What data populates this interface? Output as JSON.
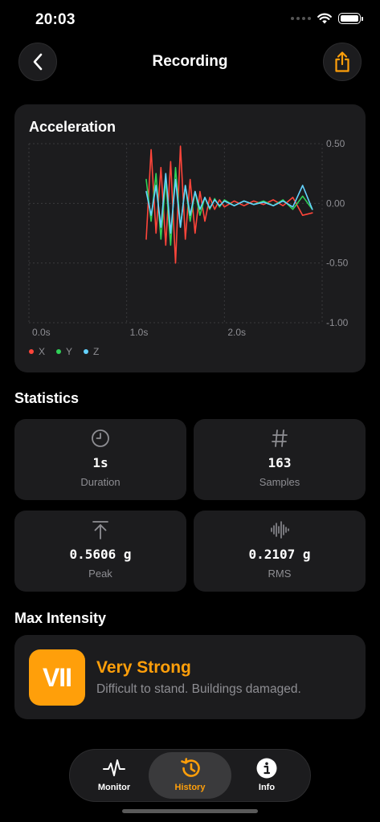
{
  "status_bar": {
    "time": "20:03"
  },
  "nav": {
    "title": "Recording"
  },
  "chart_data": {
    "type": "line",
    "title": "Acceleration",
    "x_tick_labels": [
      "0.0s",
      "1.0s",
      "2.0s"
    ],
    "y_tick_labels": [
      "0.50",
      "0.00",
      "-0.50",
      "-1.00"
    ],
    "xlim": [
      0,
      3.0
    ],
    "ylim": [
      -1.0,
      0.5
    ],
    "grid": true,
    "legend": "bottom-left",
    "series": [
      {
        "name": "X",
        "color": "#ff453a",
        "x": [
          1.2,
          1.25,
          1.3,
          1.35,
          1.4,
          1.45,
          1.5,
          1.55,
          1.6,
          1.65,
          1.7,
          1.75,
          1.8,
          1.85,
          1.9,
          1.95,
          2.0,
          2.1,
          2.2,
          2.3,
          2.4,
          2.5,
          2.6,
          2.7,
          2.8,
          2.9
        ],
        "values": [
          -0.3,
          0.45,
          -0.25,
          0.3,
          -0.35,
          0.35,
          -0.5,
          0.48,
          -0.3,
          0.2,
          -0.25,
          0.1,
          -0.15,
          0.05,
          -0.05,
          0.03,
          -0.03,
          0.02,
          -0.02,
          0.02,
          -0.01,
          0.03,
          -0.02,
          0.05,
          -0.1,
          -0.08
        ]
      },
      {
        "name": "Y",
        "color": "#30d158",
        "x": [
          1.2,
          1.25,
          1.3,
          1.35,
          1.4,
          1.45,
          1.5,
          1.55,
          1.6,
          1.65,
          1.7,
          1.75,
          1.8,
          1.85,
          1.9,
          1.95,
          2.0,
          2.1,
          2.2,
          2.3,
          2.4,
          2.5,
          2.6,
          2.7,
          2.8,
          2.9
        ],
        "values": [
          0.2,
          -0.15,
          0.25,
          -0.3,
          0.2,
          -0.35,
          0.3,
          -0.2,
          0.15,
          -0.15,
          0.1,
          -0.1,
          0.05,
          -0.05,
          0.04,
          -0.03,
          0.03,
          -0.02,
          0.02,
          -0.01,
          0.02,
          -0.02,
          0.03,
          -0.05,
          0.06,
          -0.05
        ]
      },
      {
        "name": "Z",
        "color": "#64d2ff",
        "x": [
          1.2,
          1.25,
          1.3,
          1.35,
          1.4,
          1.45,
          1.5,
          1.55,
          1.6,
          1.65,
          1.7,
          1.75,
          1.8,
          1.85,
          1.9,
          1.95,
          2.0,
          2.1,
          2.2,
          2.3,
          2.4,
          2.5,
          2.6,
          2.7,
          2.8,
          2.9
        ],
        "values": [
          0.1,
          -0.1,
          0.15,
          -0.2,
          0.25,
          -0.25,
          0.2,
          -0.2,
          0.15,
          -0.1,
          0.1,
          -0.05,
          0.05,
          -0.04,
          0.03,
          -0.02,
          0.02,
          -0.02,
          0.02,
          -0.01,
          0.01,
          -0.02,
          0.02,
          -0.03,
          0.15,
          -0.05
        ]
      }
    ]
  },
  "statistics": {
    "title": "Statistics",
    "items": [
      {
        "value": "1s",
        "label": "Duration",
        "icon": "clock-icon"
      },
      {
        "value": "163",
        "label": "Samples",
        "icon": "hash-icon"
      },
      {
        "value": "0.5606 g",
        "label": "Peak",
        "icon": "arrow-up-to-line-icon"
      },
      {
        "value": "0.2107 g",
        "label": "RMS",
        "icon": "waveform-icon"
      }
    ]
  },
  "max_intensity": {
    "title": "Max Intensity",
    "level": "VII",
    "name": "Very Strong",
    "description": "Difficult to stand. Buildings damaged.",
    "color": "#ff9f0a"
  },
  "tabs": [
    {
      "label": "Monitor",
      "icon": "waveform-pulse-icon",
      "active": false
    },
    {
      "label": "History",
      "icon": "history-icon",
      "active": true
    },
    {
      "label": "Info",
      "icon": "info-icon",
      "active": false
    }
  ],
  "colors": {
    "accent": "#ff9f0a",
    "card": "#1c1c1e",
    "secondary_text": "#8e8e93"
  }
}
